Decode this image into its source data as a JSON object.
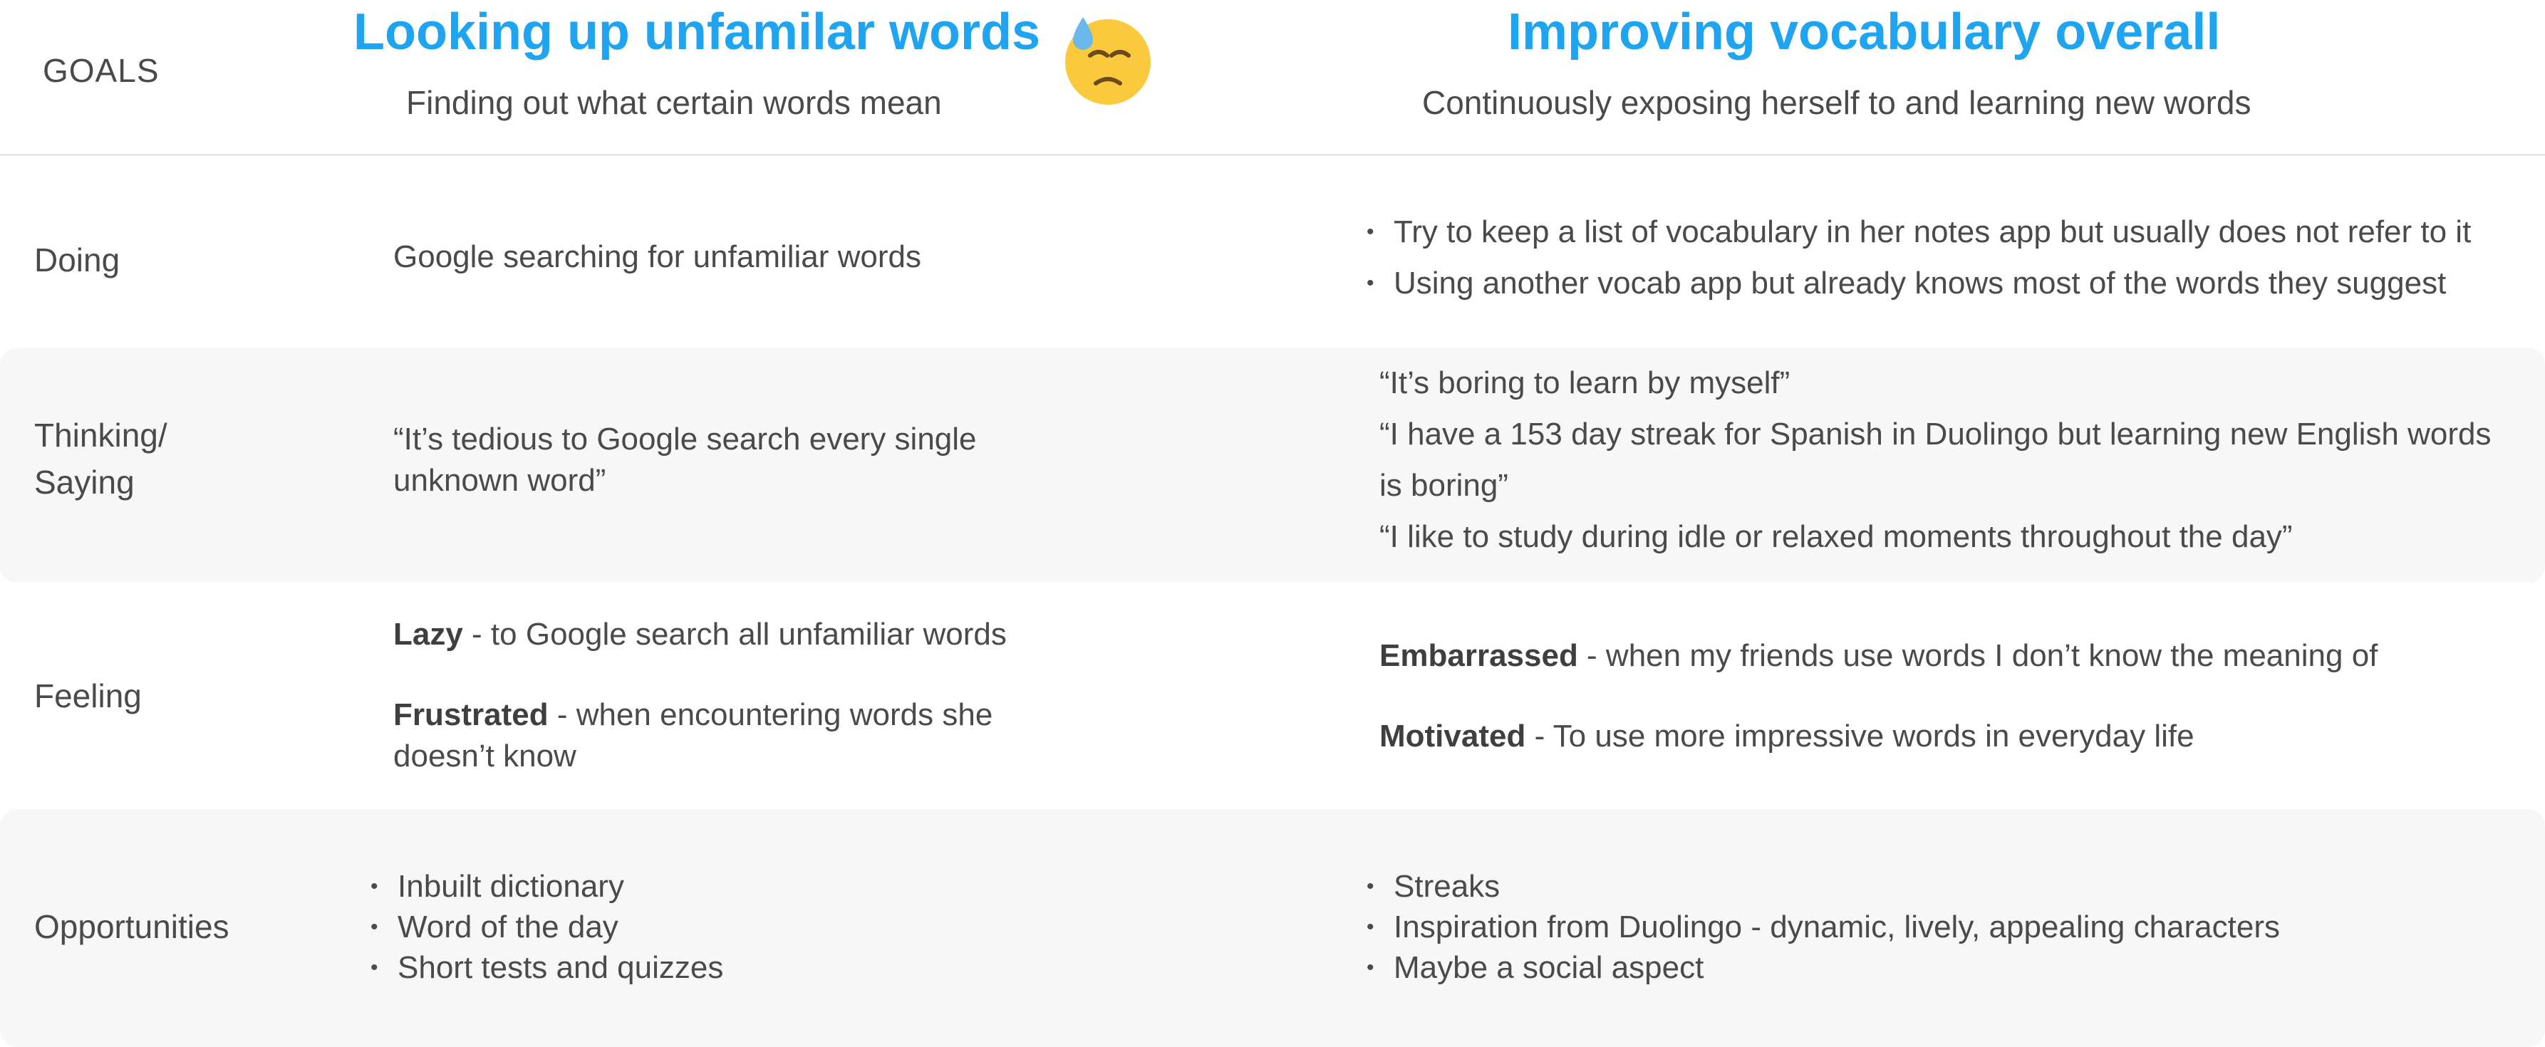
{
  "goals_label": "GOALS",
  "goals": [
    {
      "title": "Looking up unfamilar words",
      "subtitle": "Finding out what certain words mean"
    },
    {
      "title": "Improving vocabulary overall",
      "subtitle": "Continuously exposing herself to and learning new words"
    }
  ],
  "colors": {
    "accent": "#1ea4f0",
    "text": "#4a4a4a",
    "band": "#f7f7f7",
    "emoji_face": "#fbc93d"
  },
  "emoji": "downcast-face-with-sweat-icon",
  "rows": {
    "doing": {
      "label": "Doing",
      "col1": "Google searching for unfamiliar words",
      "col2": [
        "Try to keep a list of vocabulary in her notes app but usually does not refer to it",
        "Using another vocab app but already knows most of the words they suggest"
      ]
    },
    "thinking": {
      "label_line1": "Thinking/",
      "label_line2": "Saying",
      "col1_line1": "“It’s tedious to Google search every single",
      "col1_line2": "unknown word”",
      "col2": [
        "“It’s boring to learn by myself”",
        "“I have a 153 day streak for Spanish in Duolingo but learning new English words",
        "is boring”",
        "“I like to study during idle or relaxed moments throughout the day”"
      ]
    },
    "feeling": {
      "label": "Feeling",
      "col1": [
        {
          "term": "Lazy",
          "text": " - to Google search all unfamiliar words"
        },
        {
          "term": "Frustrated",
          "text": " - when encountering words she",
          "text2": "doesn’t know"
        }
      ],
      "col2": [
        {
          "term": "Embarrassed",
          "text": " - when my friends use words I don’t know the meaning of"
        },
        {
          "term": "Motivated",
          "text": " - To use more impressive words in everyday life"
        }
      ]
    },
    "opportunities": {
      "label": "Opportunities",
      "col1": [
        "Inbuilt dictionary",
        "Word of the day",
        "Short tests and quizzes"
      ],
      "col2": [
        "Streaks",
        "Inspiration from Duolingo - dynamic, lively, appealing characters",
        "Maybe a social aspect"
      ]
    }
  }
}
